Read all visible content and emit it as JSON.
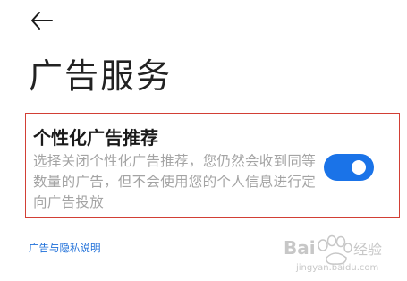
{
  "header": {
    "back_icon": "arrow-left-icon"
  },
  "page": {
    "title": "广告服务"
  },
  "setting": {
    "title": "个性化广告推荐",
    "description": "选择关闭个性化广告推荐，您仍然会收到同等数量的广告，但不会使用您的个人信息进行定向广告投放",
    "toggle_on": true,
    "toggle_color": "#1a73e8"
  },
  "footer": {
    "privacy_link": "广告与隐私说明"
  },
  "watermark": {
    "brand": "Baidu经验",
    "url": "jingyan.baidu.com"
  },
  "colors": {
    "highlight_border": "#d23f35",
    "link": "#1e6fd9",
    "description_text": "#a4a4a4"
  }
}
